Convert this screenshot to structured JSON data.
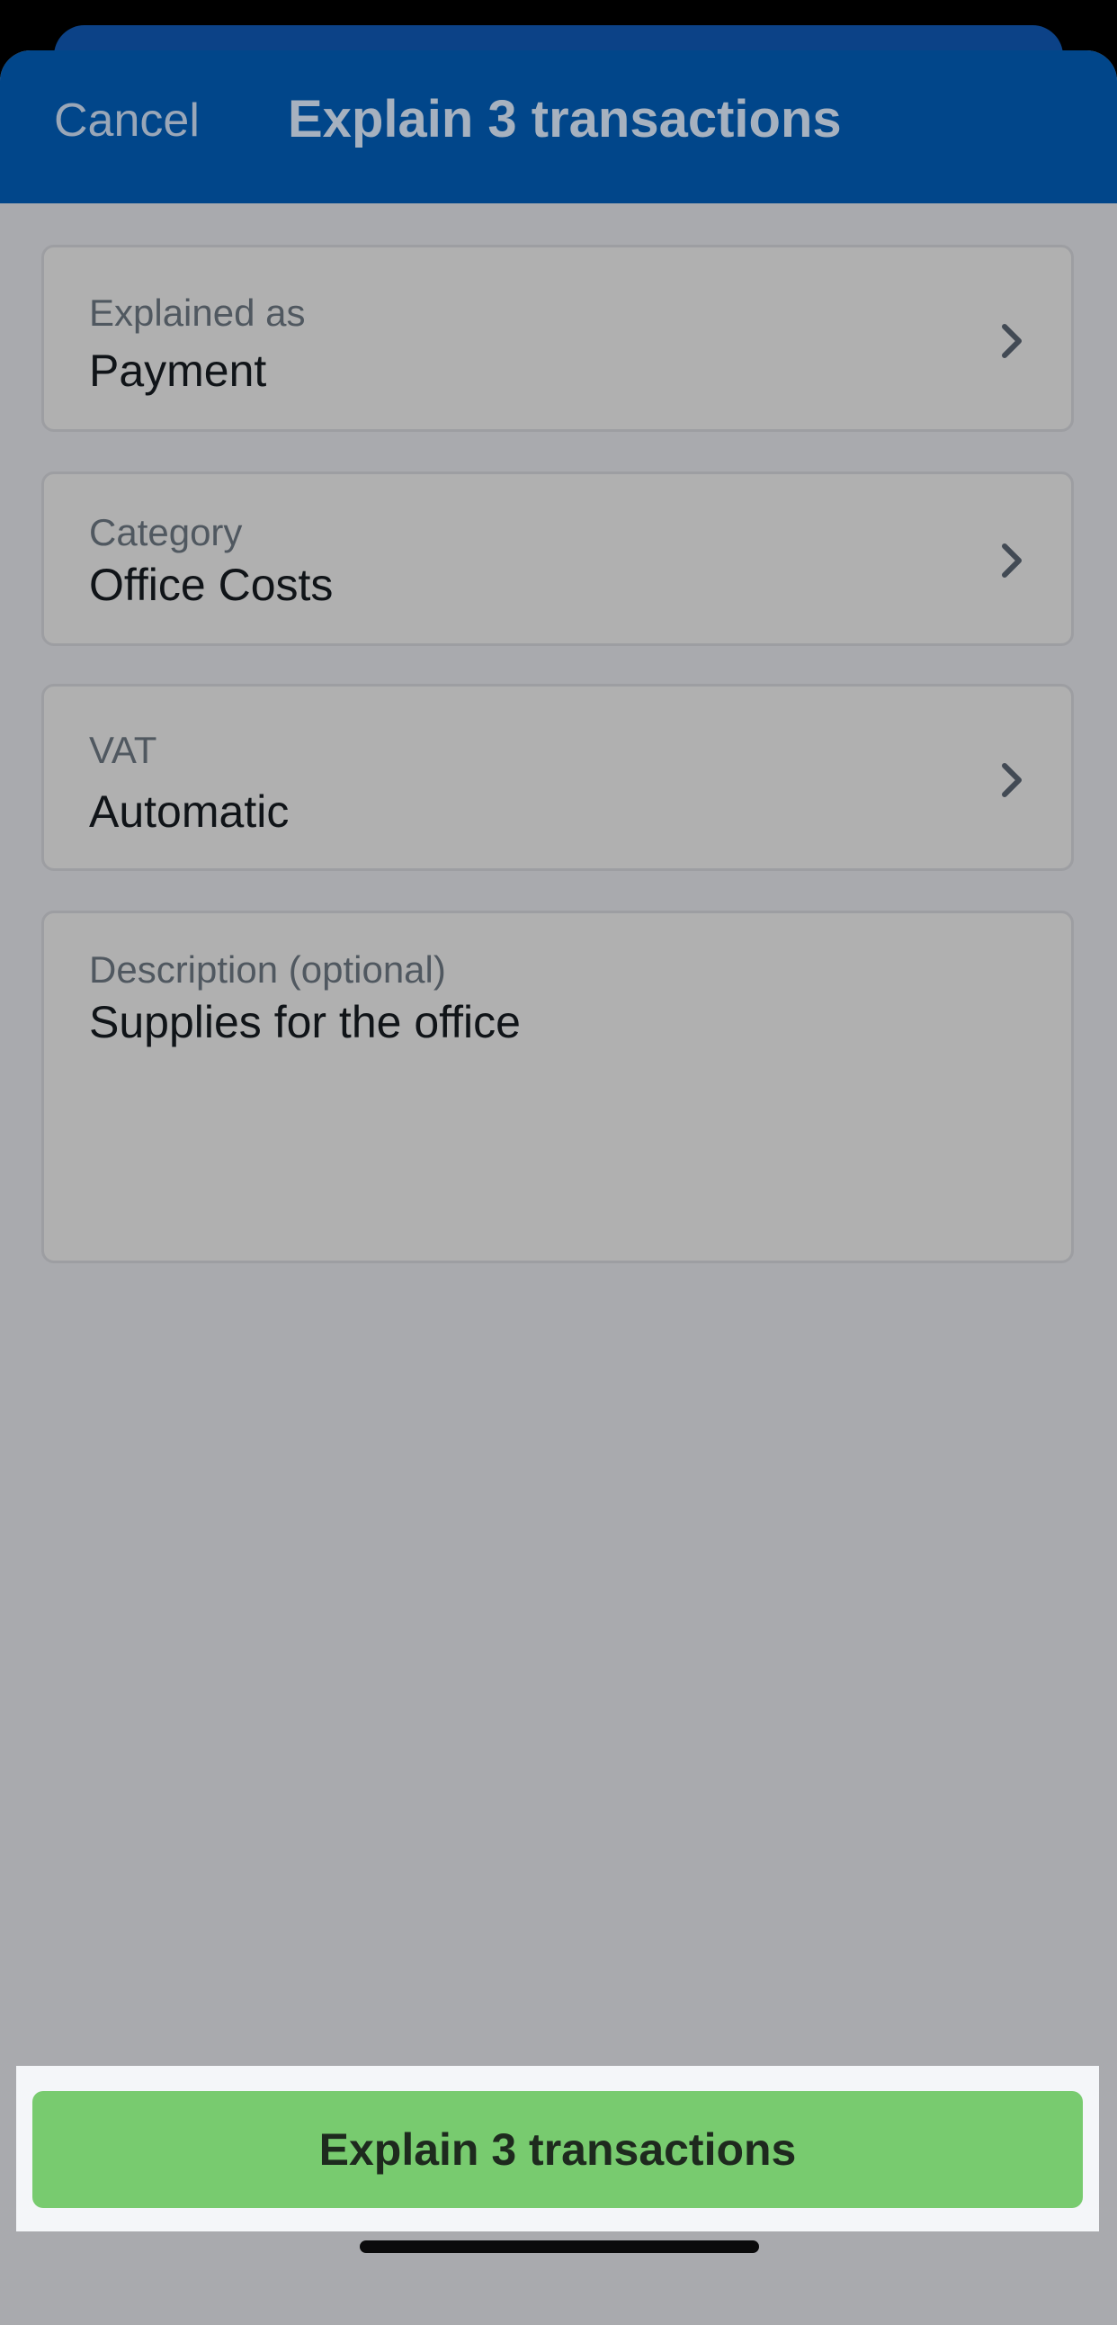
{
  "nav": {
    "cancel_label": "Cancel",
    "title": "Explain 3 transactions"
  },
  "fields": {
    "explained_as": {
      "label": "Explained as",
      "value": "Payment",
      "icon": "chevron-right-icon"
    },
    "category": {
      "label": "Category",
      "value": "Office Costs",
      "icon": "chevron-right-icon"
    },
    "vat": {
      "label": "VAT",
      "value": "Automatic",
      "icon": "chevron-right-icon"
    },
    "description": {
      "label": "Description (optional)",
      "value": "Supplies for the office"
    }
  },
  "footer": {
    "button_label": "Explain 3 transactions"
  },
  "colors": {
    "nav_background": "#01468a",
    "sheet_overlay": "#a9aaae",
    "primary_button": "#78cb6f",
    "footer_background": "#f4f6f9"
  }
}
